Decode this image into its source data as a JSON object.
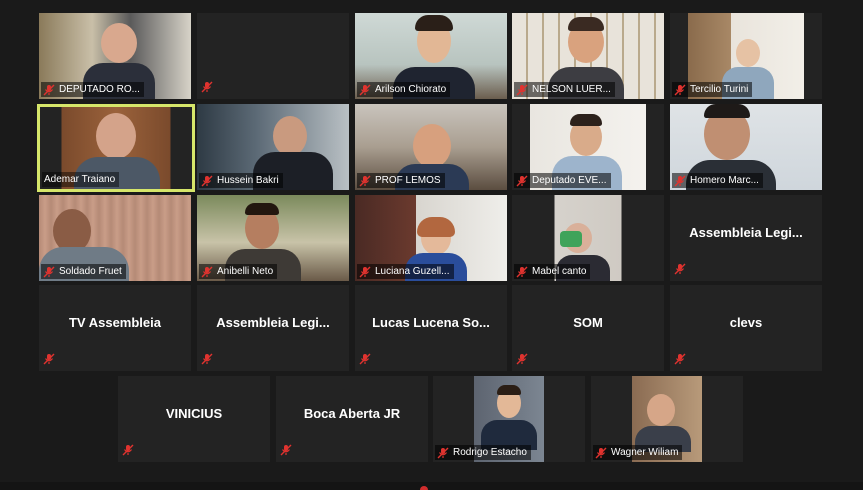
{
  "participants": [
    {
      "name": "DEPUTADO RO...",
      "has_video": true
    },
    {
      "name": "",
      "has_video": false
    },
    {
      "name": "Arilson Chiorato",
      "has_video": true
    },
    {
      "name": "NELSON LUER...",
      "has_video": true
    },
    {
      "name": "Tercilio Turini",
      "has_video": true
    },
    {
      "name": "Ademar Traiano",
      "has_video": true,
      "active_speaker": true
    },
    {
      "name": "Hussein Bakri",
      "has_video": true
    },
    {
      "name": "PROF LEMOS",
      "has_video": true
    },
    {
      "name": "Deputado EVE...",
      "has_video": true
    },
    {
      "name": "Homero Marc...",
      "has_video": true
    },
    {
      "name": "Soldado Fruet",
      "has_video": true
    },
    {
      "name": "Anibelli Neto",
      "has_video": true
    },
    {
      "name": "Luciana Guzell...",
      "has_video": true
    },
    {
      "name": "Mabel canto",
      "has_video": true
    },
    {
      "name": "Assembleia  Legi...",
      "has_video": false
    },
    {
      "name": "TV Assembleia",
      "has_video": false
    },
    {
      "name": "Assembleia  Legi...",
      "has_video": false
    },
    {
      "name": "Lucas  Lucena  So...",
      "has_video": false
    },
    {
      "name": "SOM",
      "has_video": false
    },
    {
      "name": "clevs",
      "has_video": false
    },
    {
      "name": "VINICIUS",
      "has_video": false
    },
    {
      "name": "Boca Aberta JR",
      "has_video": false
    },
    {
      "name": "Rodrigo Estacho",
      "has_video": true
    },
    {
      "name": "Wagner Wiliam",
      "has_video": true
    }
  ],
  "colors": {
    "background": "#1a1a1a",
    "tile": "#232323",
    "active_border": "#d6e66a",
    "muted_icon": "#e0332f"
  },
  "icons": {
    "muted": "mic-muted-icon"
  }
}
